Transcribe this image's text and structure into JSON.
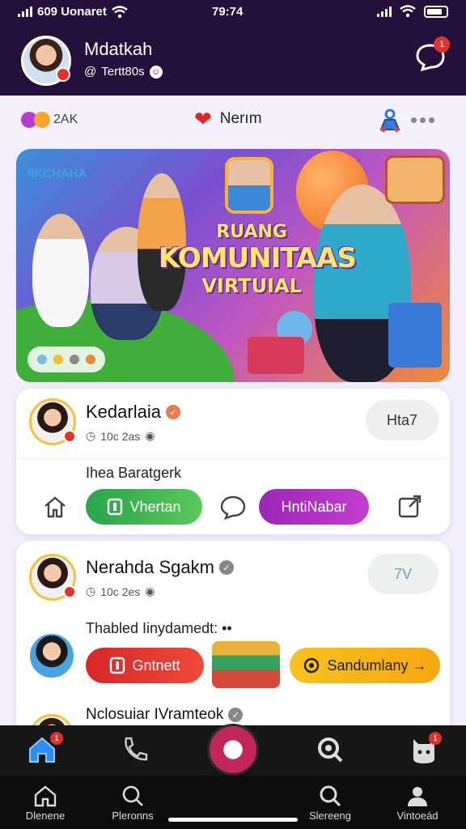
{
  "status_bar": {
    "carrier": "609 Uonaret",
    "time": "79:74"
  },
  "profile": {
    "name": "Mdatkah",
    "handle": "Tertt80s",
    "notification_count": "1"
  },
  "subheader": {
    "count": "2AK",
    "center_label": "Nerım"
  },
  "banner": {
    "tag": "IIKCHAHA",
    "headline_line1": "RUANG",
    "headline_line2": "KOMUNITAAS",
    "headline_line3": "VIRTUIAL"
  },
  "post1": {
    "name": "Kedarlaia",
    "meta": "10c 2as",
    "follow_label": "Hta7",
    "text": "Ihea Baratgerk",
    "primary_label": "Vhertan",
    "secondary_label": "HntiNabar"
  },
  "post2": {
    "name": "Nerahda Sgakm",
    "meta": "10c 2es",
    "follow_label": "7V",
    "text": "Thabled Iinydamedt:",
    "primary_label": "Gntnett",
    "secondary_label": "Sandumlany →",
    "next_name": "Nclosuiar IVramteok"
  },
  "tabbar": {
    "home_badge": "1",
    "profile_badge": "1"
  },
  "bottom_nav": [
    {
      "label": "Dlenene"
    },
    {
      "label": "Pleronns"
    },
    {
      "label": "Slereeng"
    },
    {
      "label": "Vintoeád"
    }
  ],
  "colors": {
    "header_bg": "#23103b",
    "accent_green": "#27a54a",
    "accent_purple": "#9b27b6",
    "accent_red": "#d62828",
    "accent_yellow": "#f7c21e"
  }
}
